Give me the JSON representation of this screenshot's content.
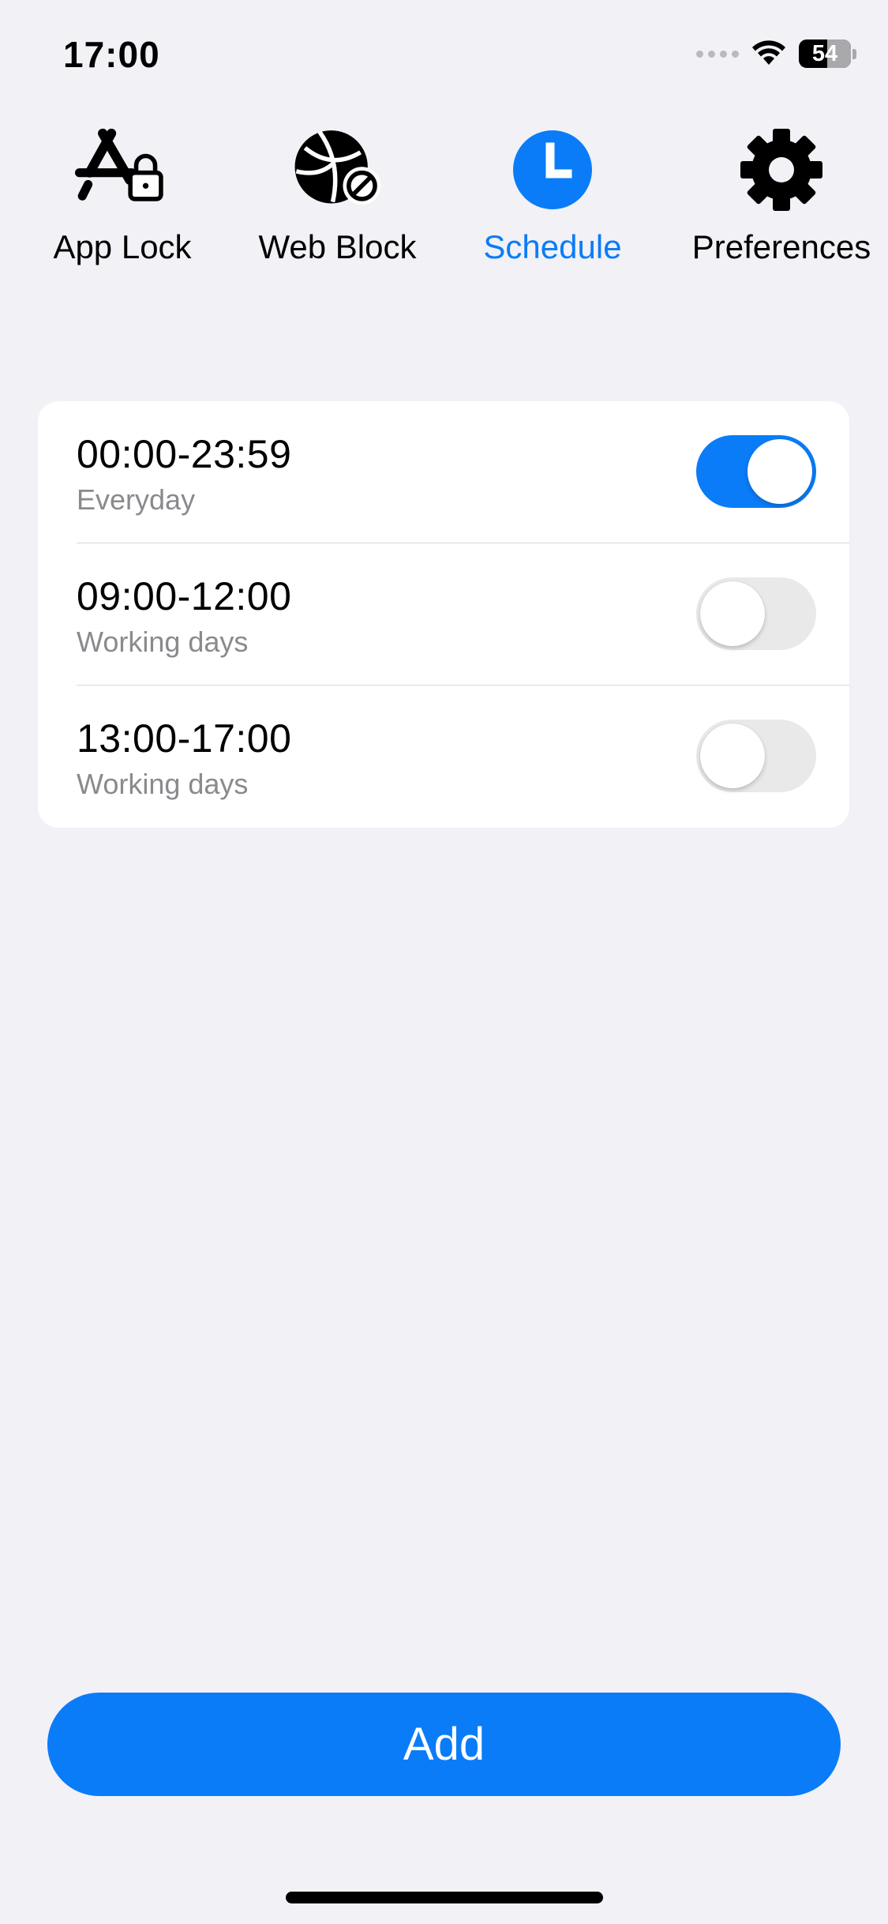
{
  "status_bar": {
    "time": "17:00",
    "battery": "54",
    "icons": [
      "cellular-signal-icon",
      "wifi-icon",
      "battery-icon"
    ]
  },
  "tabs": [
    {
      "label": "App Lock",
      "icon": "app-lock-icon",
      "active": false
    },
    {
      "label": "Web Block",
      "icon": "web-block-icon",
      "active": false
    },
    {
      "label": "Schedule",
      "icon": "clock-icon",
      "active": true
    },
    {
      "label": "Preferences",
      "icon": "gear-icon",
      "active": false
    }
  ],
  "schedules": [
    {
      "time": "00:00-23:59",
      "days": "Everyday",
      "enabled": true
    },
    {
      "time": "09:00-12:00",
      "days": "Working days",
      "enabled": false
    },
    {
      "time": "13:00-17:00",
      "days": "Working days",
      "enabled": false
    }
  ],
  "add_button": {
    "label": "Add"
  },
  "colors": {
    "accent": "#0a7cf8",
    "background": "#f1f1f6",
    "toggle_off": "#e9e9ea"
  }
}
